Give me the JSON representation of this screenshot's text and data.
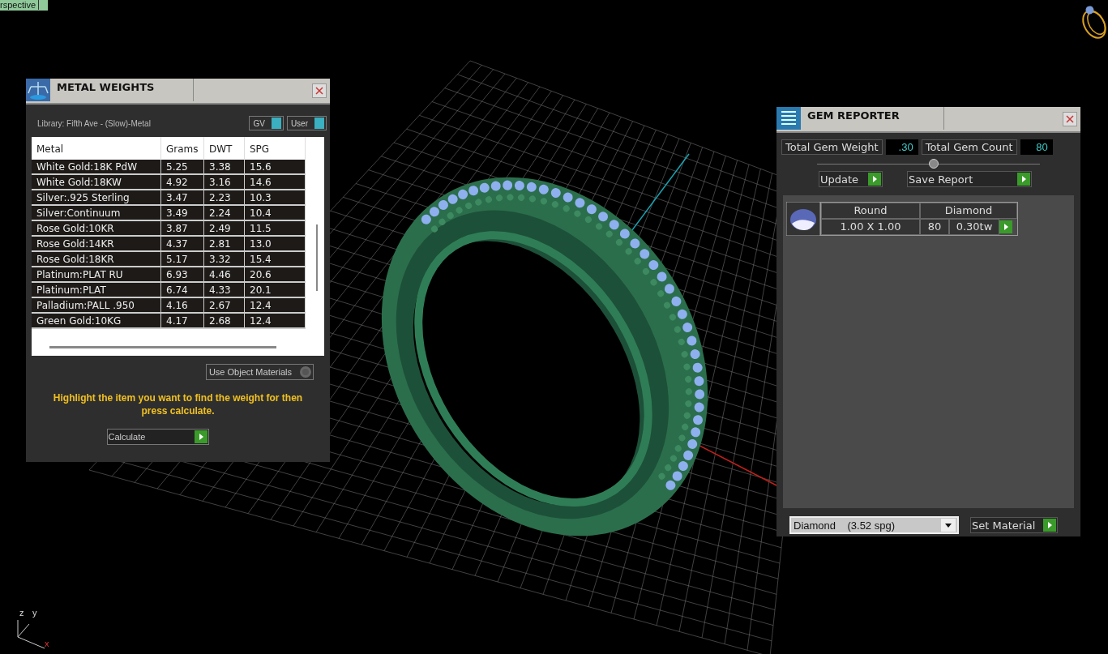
{
  "viewport": {
    "view_label": "rspective",
    "axis_labels": [
      "z",
      "y",
      "x"
    ]
  },
  "metal_weights": {
    "title": "METAL WEIGHTS",
    "library": "Library: Fifth Ave - (Slow)-Metal",
    "toggles": [
      {
        "label": "GV",
        "on": true
      },
      {
        "label": "User",
        "on": true
      }
    ],
    "table": {
      "columns": [
        "Metal",
        "Grams",
        "DWT",
        "SPG"
      ],
      "rows": [
        [
          "White Gold:18K PdW",
          "5.25",
          "3.38",
          "15.6"
        ],
        [
          "White Gold:18KW",
          "4.92",
          "3.16",
          "14.6"
        ],
        [
          "Silver:.925 Sterling",
          "3.47",
          "2.23",
          "10.3"
        ],
        [
          "Silver:Continuum",
          "3.49",
          "2.24",
          "10.4"
        ],
        [
          "Rose Gold:10KR",
          "3.87",
          "2.49",
          "11.5"
        ],
        [
          "Rose Gold:14KR",
          "4.37",
          "2.81",
          "13.0"
        ],
        [
          "Rose Gold:18KR",
          "5.17",
          "3.32",
          "15.4"
        ],
        [
          "Platinum:PLAT RU",
          "6.93",
          "4.46",
          "20.6"
        ],
        [
          "Platinum:PLAT",
          "6.74",
          "4.33",
          "20.1"
        ],
        [
          "Palladium:PALL .950",
          "4.16",
          "2.67",
          "12.4"
        ],
        [
          "Green Gold:10KG",
          "4.17",
          "2.68",
          "12.4"
        ]
      ]
    },
    "object_materials": {
      "label": "Use Object Materials",
      "on": false
    },
    "hint": "Highlight the item you want to find the weight for then press calculate.",
    "calculate_button": "Calculate"
  },
  "gem_reporter": {
    "title": "GEM REPORTER",
    "total_weight_label": "Total Gem Weight",
    "total_weight": ".30",
    "total_count_label": "Total Gem Count",
    "total_count": "80",
    "buttons": [
      "Update",
      "Save Report"
    ],
    "gems": [
      {
        "shape": "Round",
        "material": "Diamond",
        "size": "1.00 X 1.00",
        "count": "80",
        "weight": "0.30tw"
      }
    ],
    "material_select": "Diamond    (3.52 spg)",
    "set_material_button": "Set Material"
  }
}
